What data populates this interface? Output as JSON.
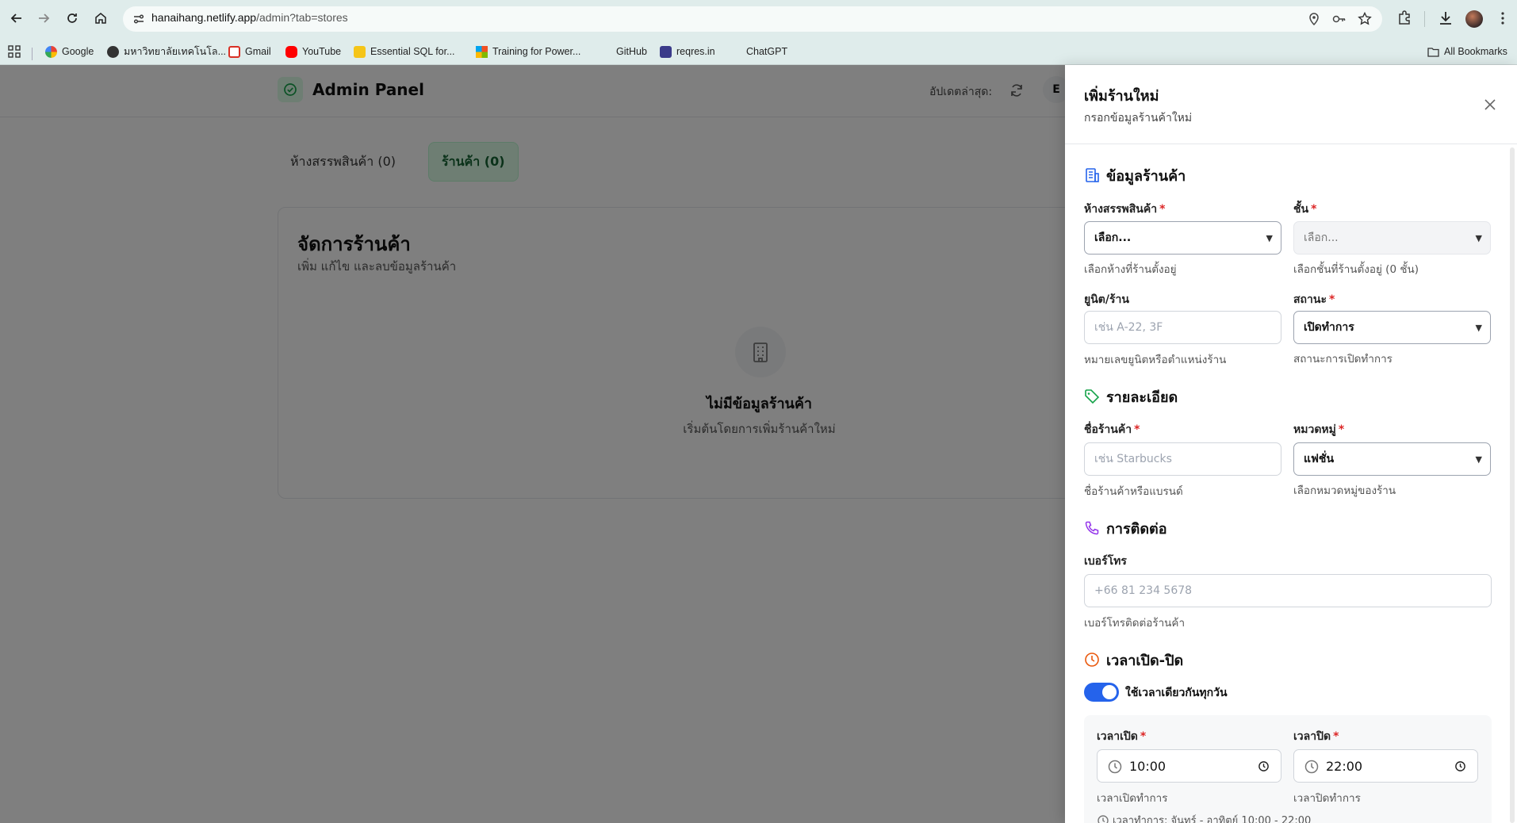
{
  "browser": {
    "url_host": "hanaihang.netlify.app",
    "url_path": "/admin?tab=stores",
    "bookmarks": [
      "Google",
      "มหาวิทยาลัยเทคโนโล...",
      "Gmail",
      "YouTube",
      "Essential SQL for...",
      "Training for Power...",
      "GitHub",
      "reqres.in",
      "ChatGPT"
    ],
    "all_bookmarks": "All Bookmarks"
  },
  "app": {
    "title": "Admin Panel",
    "last_update": "อัปเดตล่าสุด:",
    "user_initial": "E",
    "tabs": [
      {
        "label": "ห้างสรรพสินค้า (0)"
      },
      {
        "label": "ร้านค้า (0)"
      }
    ],
    "card": {
      "title": "จัดการร้านค้า",
      "subtitle": "เพิ่ม แก้ไข และลบข้อมูลร้านค้า",
      "empty_title": "ไม่มีข้อมูลร้านค้า",
      "empty_sub": "เริ่มต้นโดยการเพิ่มร้านค้าใหม่"
    }
  },
  "drawer": {
    "title": "เพิ่มร้านใหม่",
    "subtitle": "กรอกข้อมูลร้านค้าใหม่",
    "sections": {
      "info": "ข้อมูลร้านค้า",
      "details": "รายละเอียด",
      "contact": "การติดต่อ",
      "hours": "เวลาเปิด-ปิด"
    },
    "fields": {
      "mall": {
        "label": "ห้างสรรพสินค้า",
        "value": "เลือก...",
        "hint": "เลือกห้างที่ร้านตั้งอยู่"
      },
      "floor": {
        "label": "ชั้น",
        "value": "เลือก...",
        "hint": "เลือกชั้นที่ร้านตั้งอยู่ (0 ชั้น)"
      },
      "unit": {
        "label": "ยูนิต/ร้าน",
        "placeholder": "เช่น A-22, 3F",
        "hint": "หมายเลขยูนิตหรือตำแหน่งร้าน"
      },
      "status": {
        "label": "สถานะ",
        "value": "เปิดทำการ",
        "hint": "สถานะการเปิดทำการ"
      },
      "name": {
        "label": "ชื่อร้านค้า",
        "placeholder": "เช่น Starbucks",
        "hint": "ชื่อร้านค้าหรือแบรนด์"
      },
      "category": {
        "label": "หมวดหมู่",
        "value": "แฟชั่น",
        "hint": "เลือกหมวดหมู่ของร้าน"
      },
      "phone": {
        "label": "เบอร์โทร",
        "placeholder": "+66 81 234 5678",
        "hint": "เบอร์โทรติดต่อร้านค้า"
      }
    },
    "hours": {
      "same_every_day": "ใช้เวลาเดียวกันทุกวัน",
      "same_every_day_on": true,
      "open": {
        "label": "เวลาเปิด",
        "value": "10:00",
        "hint": "เวลาเปิดทำการ"
      },
      "close": {
        "label": "เวลาปิด",
        "value": "22:00",
        "hint": "เวลาปิดทำการ"
      },
      "summary": "เวลาทำการ: จันทร์ - อาทิตย์ 10:00 - 22:00"
    }
  },
  "colors": {
    "accent_blue": "#2563eb",
    "brand_green": "#16a34a",
    "required_red": "#dc2626"
  }
}
